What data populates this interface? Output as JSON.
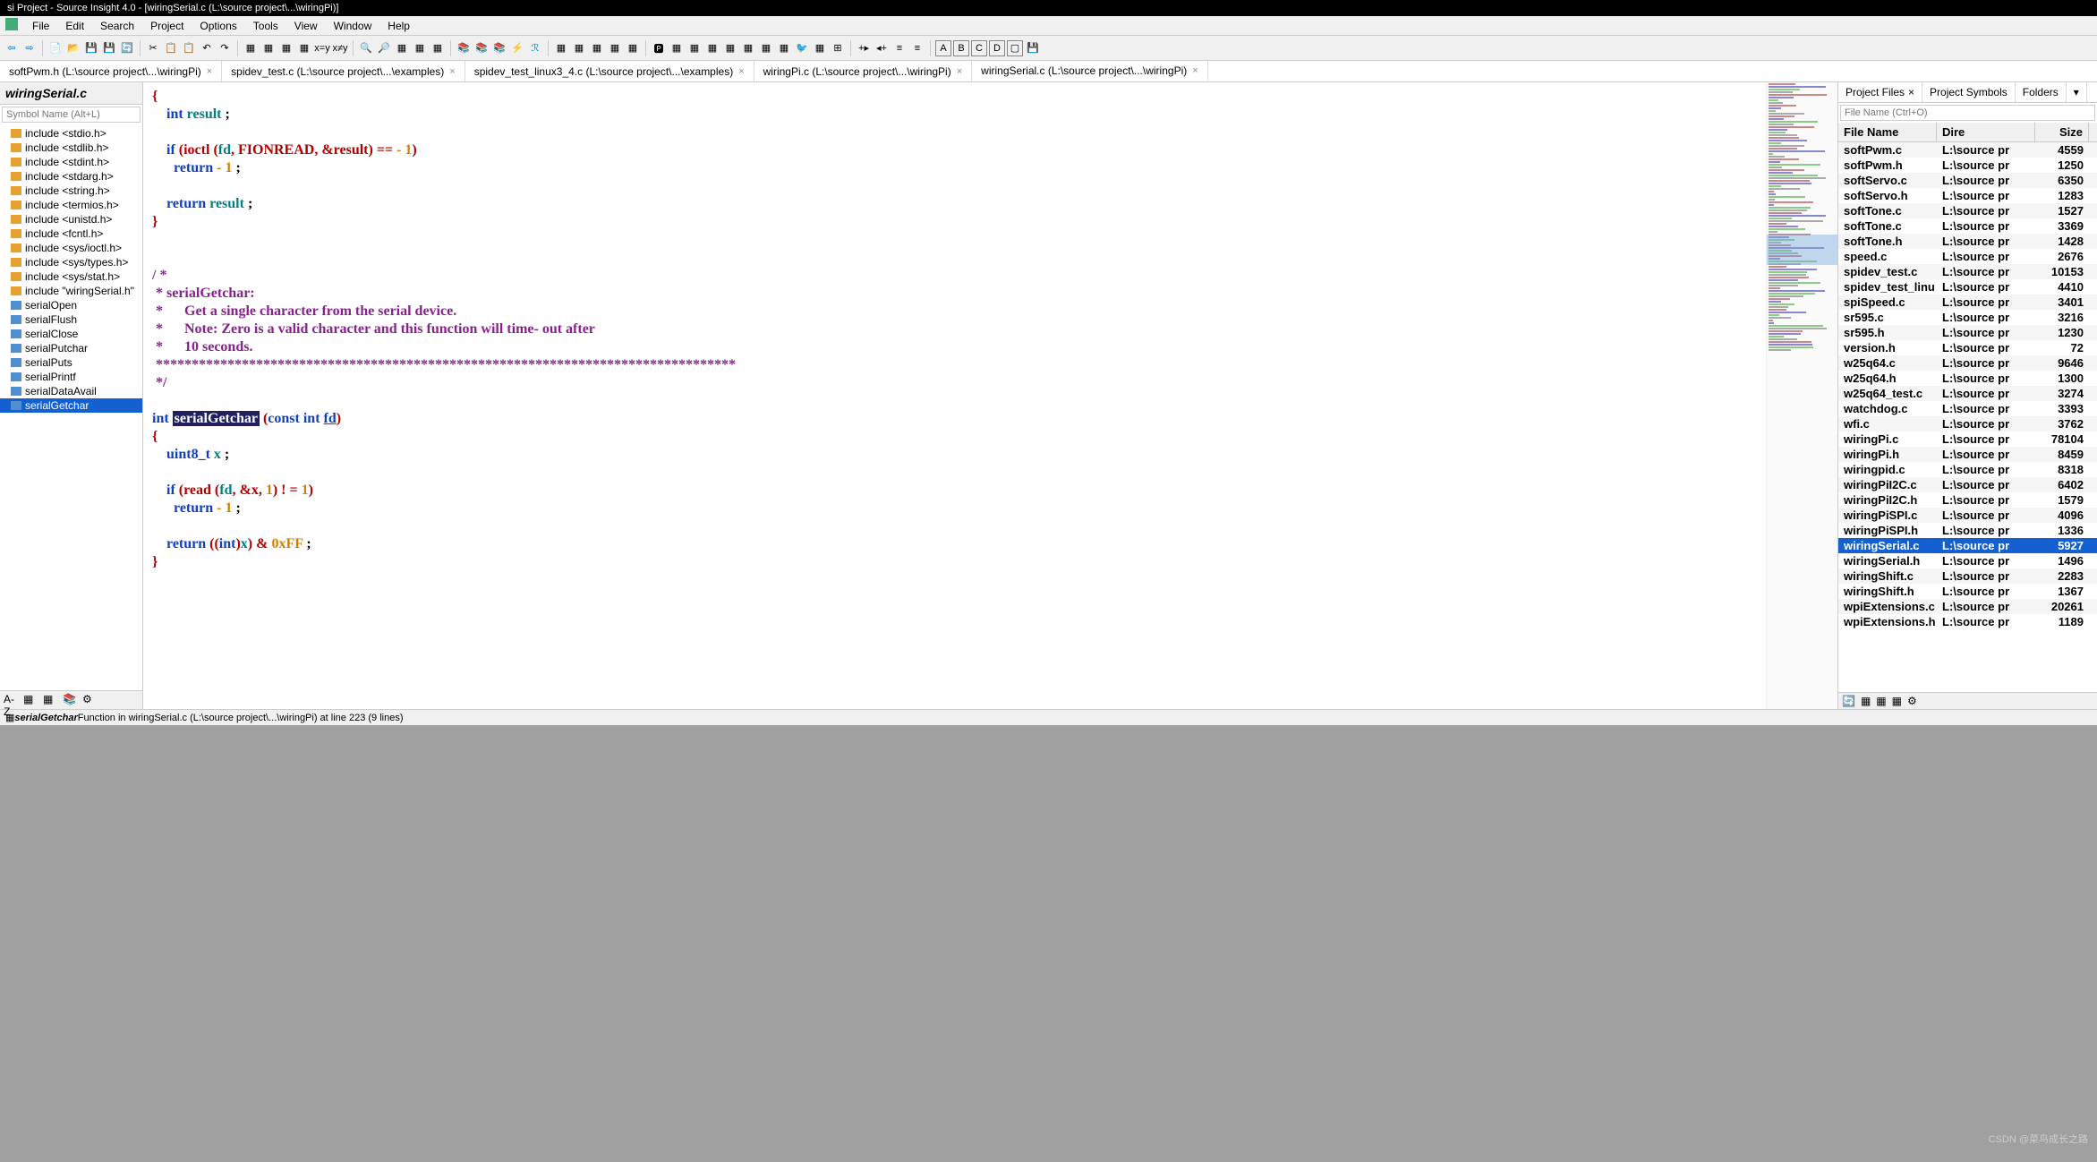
{
  "title": "si Project - Source Insight 4.0 - [wiringSerial.c (L:\\source project\\...\\wiringPi)]",
  "menu": [
    "File",
    "Edit",
    "Search",
    "Project",
    "Options",
    "Tools",
    "View",
    "Window",
    "Help"
  ],
  "tabs": [
    {
      "label": "softPwm.h (L:\\source project\\...\\wiringPi)",
      "active": false
    },
    {
      "label": "spidev_test.c (L:\\source project\\...\\examples)",
      "active": false
    },
    {
      "label": "spidev_test_linux3_4.c (L:\\source project\\...\\examples)",
      "active": false
    },
    {
      "label": "wiringPi.c (L:\\source project\\...\\wiringPi)",
      "active": false
    },
    {
      "label": "wiringSerial.c (L:\\source project\\...\\wiringPi)",
      "active": true
    }
  ],
  "left": {
    "title": "wiringSerial.c",
    "placeholder": "Symbol Name (Alt+L)",
    "items": [
      {
        "t": "inc",
        "l": "include <stdio.h>"
      },
      {
        "t": "inc",
        "l": "include <stdlib.h>"
      },
      {
        "t": "inc",
        "l": "include <stdint.h>"
      },
      {
        "t": "inc",
        "l": "include <stdarg.h>"
      },
      {
        "t": "inc",
        "l": "include <string.h>"
      },
      {
        "t": "inc",
        "l": "include <termios.h>"
      },
      {
        "t": "inc",
        "l": "include <unistd.h>"
      },
      {
        "t": "inc",
        "l": "include <fcntl.h>"
      },
      {
        "t": "inc",
        "l": "include <sys/ioctl.h>"
      },
      {
        "t": "inc",
        "l": "include <sys/types.h>"
      },
      {
        "t": "inc",
        "l": "include <sys/stat.h>"
      },
      {
        "t": "inc",
        "l": "include \"wiringSerial.h\""
      },
      {
        "t": "fn",
        "l": "serialOpen"
      },
      {
        "t": "fn",
        "l": "serialFlush"
      },
      {
        "t": "fn",
        "l": "serialClose"
      },
      {
        "t": "fn",
        "l": "serialPutchar"
      },
      {
        "t": "fn",
        "l": "serialPuts"
      },
      {
        "t": "fn",
        "l": "serialPrintf"
      },
      {
        "t": "fn",
        "l": "serialDataAvail"
      },
      {
        "t": "fn",
        "l": "serialGetchar",
        "sel": true
      }
    ]
  },
  "code": {
    "brace_open": "{",
    "int_kw": "int",
    "result": "result",
    "semi": ";",
    "if_kw": "if",
    "ioctl": "ioctl",
    "fd": "fd",
    "fionread": "FIONREAD",
    "amp_result": "&result",
    "eqeq": "==",
    "neg1": "- 1",
    "return_kw": "return",
    "brace_close": "}",
    "cm1": "/ *",
    "cm2": " * serialGetchar:",
    "cm3": " *      Get a single character from the serial device.",
    "cm4": " *      Note: Zero is a valid character and this function will time- out after",
    "cm5": " *      10 seconds.",
    "cm6": " *********************************************************************************",
    "cm7": " */",
    "fn_name": "serialGetchar",
    "const": "const",
    "int": "int",
    "uint8": "uint8_t",
    "x": "x",
    "read": "read",
    "amp_x": "&x",
    "one": "1",
    "neq": "! =",
    "cast_open": "((",
    "cast_int": "int",
    "cast_close": ")",
    "and": "&",
    "hex": "0xFF"
  },
  "right": {
    "tabs": [
      "Project Files",
      "Project Symbols",
      "Folders"
    ],
    "placeholder": "File Name (Ctrl+O)",
    "hdr": {
      "fn": "File Name",
      "dir": "Dire",
      "sz": "Size"
    },
    "rows": [
      {
        "fn": "softPwm.c",
        "dir": "L:\\source pr",
        "sz": "4559"
      },
      {
        "fn": "softPwm.h",
        "dir": "L:\\source pr",
        "sz": "1250"
      },
      {
        "fn": "softServo.c",
        "dir": "L:\\source pr",
        "sz": "6350"
      },
      {
        "fn": "softServo.h",
        "dir": "L:\\source pr",
        "sz": "1283"
      },
      {
        "fn": "softTone.c",
        "dir": "L:\\source pr",
        "sz": "1527"
      },
      {
        "fn": "softTone.c",
        "dir": "L:\\source pr",
        "sz": "3369"
      },
      {
        "fn": "softTone.h",
        "dir": "L:\\source pr",
        "sz": "1428"
      },
      {
        "fn": "speed.c",
        "dir": "L:\\source pr",
        "sz": "2676"
      },
      {
        "fn": "spidev_test.c",
        "dir": "L:\\source pr",
        "sz": "10153"
      },
      {
        "fn": "spidev_test_linu",
        "dir": "L:\\source pr",
        "sz": "4410"
      },
      {
        "fn": "spiSpeed.c",
        "dir": "L:\\source pr",
        "sz": "3401"
      },
      {
        "fn": "sr595.c",
        "dir": "L:\\source pr",
        "sz": "3216"
      },
      {
        "fn": "sr595.h",
        "dir": "L:\\source pr",
        "sz": "1230"
      },
      {
        "fn": "version.h",
        "dir": "L:\\source pr",
        "sz": "72"
      },
      {
        "fn": "w25q64.c",
        "dir": "L:\\source pr",
        "sz": "9646"
      },
      {
        "fn": "w25q64.h",
        "dir": "L:\\source pr",
        "sz": "1300"
      },
      {
        "fn": "w25q64_test.c",
        "dir": "L:\\source pr",
        "sz": "3274"
      },
      {
        "fn": "watchdog.c",
        "dir": "L:\\source pr",
        "sz": "3393"
      },
      {
        "fn": "wfi.c",
        "dir": "L:\\source pr",
        "sz": "3762"
      },
      {
        "fn": "wiringPi.c",
        "dir": "L:\\source pr",
        "sz": "78104"
      },
      {
        "fn": "wiringPi.h",
        "dir": "L:\\source pr",
        "sz": "8459"
      },
      {
        "fn": "wiringpid.c",
        "dir": "L:\\source pr",
        "sz": "8318"
      },
      {
        "fn": "wiringPiI2C.c",
        "dir": "L:\\source pr",
        "sz": "6402"
      },
      {
        "fn": "wiringPiI2C.h",
        "dir": "L:\\source pr",
        "sz": "1579"
      },
      {
        "fn": "wiringPiSPI.c",
        "dir": "L:\\source pr",
        "sz": "4096"
      },
      {
        "fn": "wiringPiSPI.h",
        "dir": "L:\\source pr",
        "sz": "1336"
      },
      {
        "fn": "wiringSerial.c",
        "dir": "L:\\source pr",
        "sz": "5927",
        "sel": true
      },
      {
        "fn": "wiringSerial.h",
        "dir": "L:\\source pr",
        "sz": "1496"
      },
      {
        "fn": "wiringShift.c",
        "dir": "L:\\source pr",
        "sz": "2283"
      },
      {
        "fn": "wiringShift.h",
        "dir": "L:\\source pr",
        "sz": "1367"
      },
      {
        "fn": "wpiExtensions.c",
        "dir": "L:\\source pr",
        "sz": "20261"
      },
      {
        "fn": "wpiExtensions.h",
        "dir": "L:\\source pr",
        "sz": "1189"
      }
    ]
  },
  "status_prefix": "serialGetchar",
  "status": " Function in wiringSerial.c (L:\\source project\\...\\wiringPi) at line 223 (9 lines)",
  "watermark": "CSDN @菜鸟成长之路"
}
